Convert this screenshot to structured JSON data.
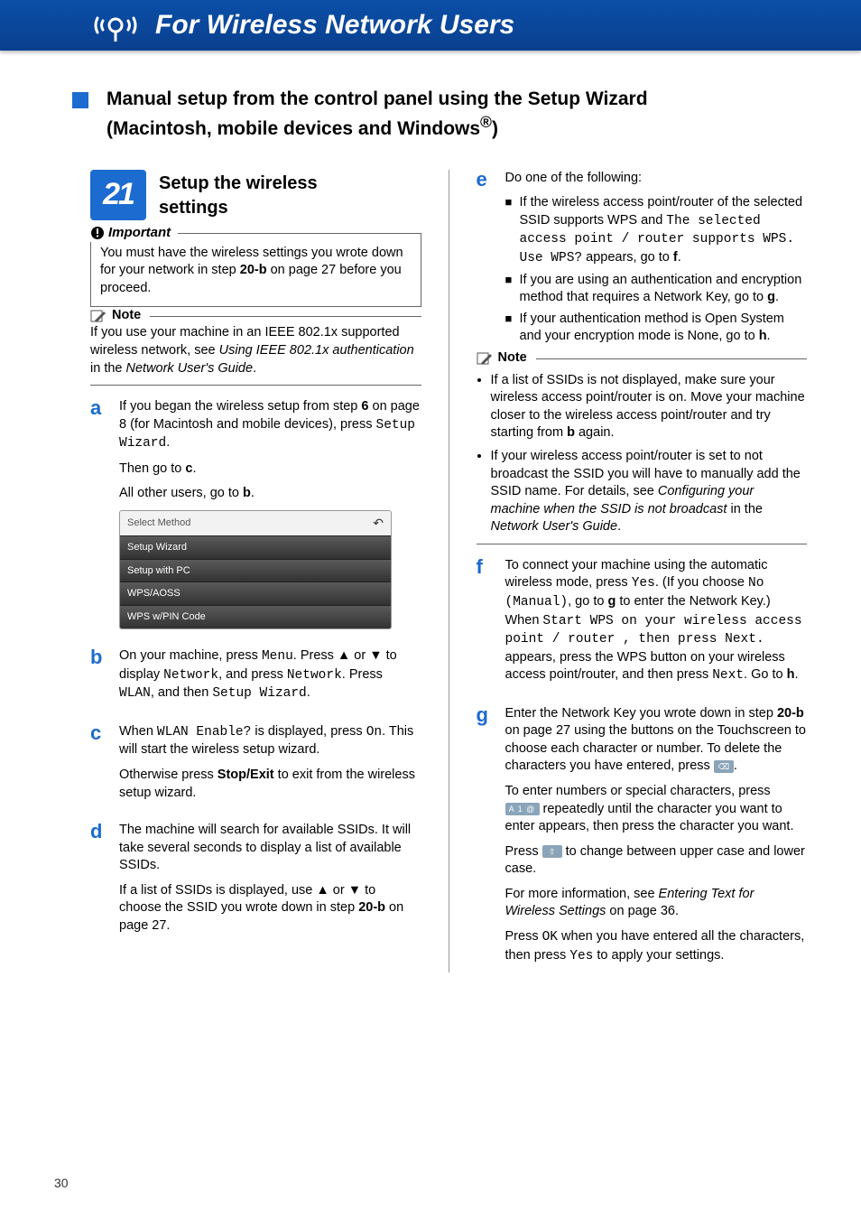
{
  "banner": {
    "title": "For Wireless Network Users"
  },
  "main_title_l1": "Manual setup from the control panel using the Setup Wizard",
  "main_title_l2": "(Macintosh, mobile devices and Windows",
  "main_title_sup": "®",
  "main_title_end": ")",
  "step21": {
    "number": "21",
    "title_l1": "Setup the wireless",
    "title_l2": "settings"
  },
  "important": {
    "label": "Important",
    "body_pre": "You must have the wireless settings you wrote down for your network in step ",
    "bold": "20-b",
    "body_post": " on page 27 before you proceed."
  },
  "note1": {
    "label": "Note",
    "text_pre": "If you use your machine in an IEEE 802.1x supported wireless network, see ",
    "i1": "Using IEEE 802.1x authentication",
    "mid": " in the ",
    "i2": "Network User's Guide",
    "end": "."
  },
  "a": {
    "letter": "a",
    "p1_pre": "If you began the wireless setup from step ",
    "p1_b": "6",
    "p1_mid": " on page 8 (for Macintosh and mobile devices), press ",
    "p1_mono": "Setup Wizard",
    "p1_end": ".",
    "p2_pre": "Then go to ",
    "p2_b": "c",
    "p2_end": ".",
    "p3_pre": "All other users, go to ",
    "p3_b": "b",
    "p3_end": "."
  },
  "screenshot": {
    "header": "Select Method",
    "rows": [
      "Setup Wizard",
      "Setup with PC",
      "WPS/AOSS",
      "WPS w/PIN Code"
    ]
  },
  "b": {
    "letter": "b",
    "p": "On your machine, press ",
    "m1": "Menu",
    "p2": ".\nPress ▲ or ▼ to display ",
    "m2": "Network",
    "p3": ", and press ",
    "m3": "Network",
    "p4": ".\nPress ",
    "m4": "WLAN",
    "p5": ", and then ",
    "m5": "Setup Wizard",
    "p6": "."
  },
  "c": {
    "letter": "c",
    "p1_pre": "When ",
    "p1_m": "WLAN Enable?",
    "p1_mid": " is displayed, press ",
    "p1_m2": "On",
    "p1_end": ". This will start the wireless setup wizard.",
    "p2_pre": "Otherwise press ",
    "p2_b": "Stop/Exit",
    "p2_end": " to exit from the wireless setup wizard."
  },
  "d": {
    "letter": "d",
    "p1": "The machine will search for available SSIDs. It will take several seconds to display a list of available SSIDs.",
    "p2_pre": "If a list of SSIDs is displayed, use ▲ or ▼ to choose the SSID you wrote down in step ",
    "p2_b": "20-b",
    "p2_end": " on page 27."
  },
  "e": {
    "letter": "e",
    "intro": "Do one of the following:",
    "bul1_pre": "If the wireless access point/router of the selected SSID supports WPS and ",
    "bul1_m": "The selected access point / router supports WPS. Use WPS?",
    "bul1_mid": " appears, go to ",
    "bul1_b": "f",
    "bul1_end": ".",
    "bul2_pre": "If you are using an authentication and encryption method that requires a Network Key, go to ",
    "bul2_b": "g",
    "bul2_end": ".",
    "bul3_pre": "If your authentication method is Open System and your encryption mode is None, go to ",
    "bul3_b": "h",
    "bul3_end": "."
  },
  "note2": {
    "label": "Note",
    "li1_pre": "If a list of SSIDs is not displayed, make sure your wireless access point/router is on. Move your machine closer to the wireless access point/router and try starting from ",
    "li1_b": "b",
    "li1_end": " again.",
    "li2_pre": "If your wireless access point/router is set to not broadcast the SSID you will have to manually add the SSID name. For details, see ",
    "li2_i": "Configuring your machine when the SSID is not broadcast",
    "li2_mid": " in the ",
    "li2_i2": "Network User's Guide",
    "li2_end": "."
  },
  "f": {
    "letter": "f",
    "p_pre": "To connect your machine using the automatic wireless mode, press ",
    "m1": "Yes",
    "p2": ". (If you choose ",
    "m2": "No (Manual)",
    "p3": ", go to ",
    "b1": "g",
    "p4": " to enter the Network Key.) When ",
    "m3": "Start WPS on your wireless access point / router , then press Next.",
    "p5": " appears, press the WPS button on your wireless access point/router, and then press ",
    "m4": "Next",
    "p6": ". Go to ",
    "b2": "h",
    "p7": "."
  },
  "g": {
    "letter": "g",
    "p1_pre": "Enter the Network Key you wrote down in step ",
    "p1_b": "20-b",
    "p1_mid": " on page 27 using the buttons on the Touchscreen to choose each character or number. To delete the characters you have entered, press ",
    "p1_end": ".",
    "p2": "To enter numbers or special characters, press ",
    "p2_mid": " repeatedly until the character you want to enter appears, then press the character you want.",
    "p3_pre": "Press ",
    "p3_end": " to change between upper case and lower case.",
    "p4_pre": "For more information, see ",
    "p4_i": "Entering Text for Wireless Settings",
    "p4_end": " on page 36.",
    "p5_pre": "Press ",
    "p5_m1": "OK",
    "p5_mid": " when you have entered all the characters, then press ",
    "p5_m2": "Yes",
    "p5_end": " to apply your settings."
  },
  "page": "30"
}
